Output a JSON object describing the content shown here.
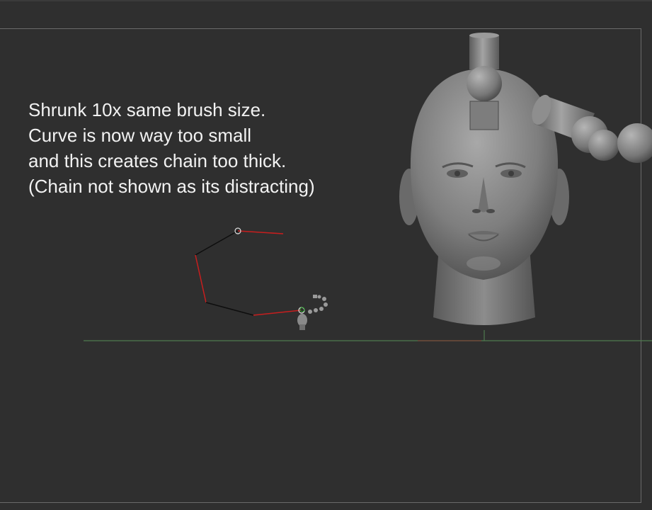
{
  "annotation": {
    "lines": [
      "Shrunk 10x same brush size.",
      "Curve is now way too small",
      "and this creates chain too thick.",
      "(Chain not shown as its distracting)"
    ]
  },
  "colors": {
    "background": "#2f2f2f",
    "frame": "#6a6a6a",
    "text": "#f2f2f2",
    "curve_red": "#c81e1e",
    "curve_black": "#0e0e0e",
    "ground_green": "#4f7a4f",
    "model_gray": "#8a8a8a"
  },
  "icons": {
    "curve_node": "circle-node-icon",
    "head_model": "sculpt-head-icon"
  }
}
